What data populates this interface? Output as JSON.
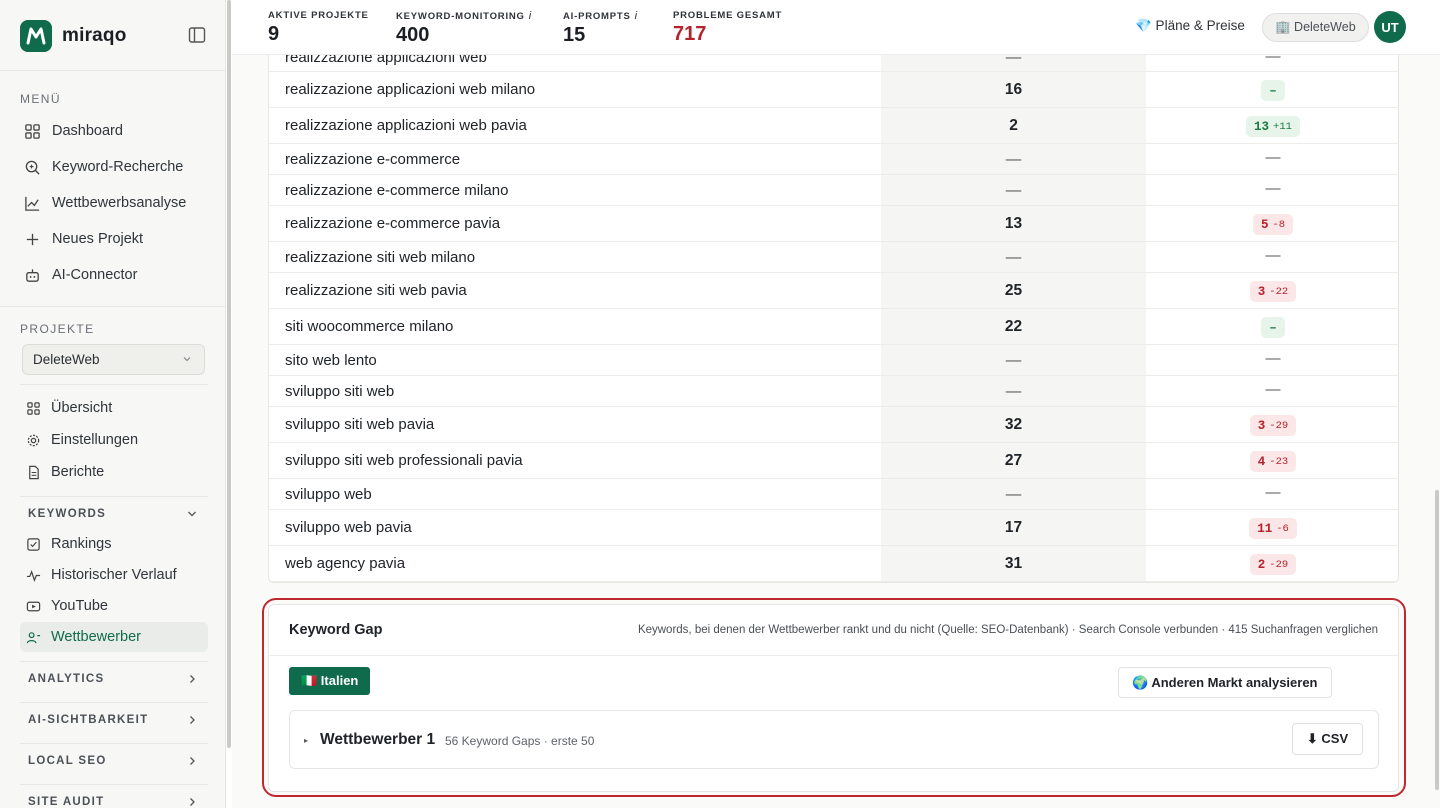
{
  "brand": {
    "name": "miraqo"
  },
  "sidebar": {
    "menu_heading": "MENÜ",
    "menu_items": [
      {
        "label": "Dashboard",
        "icon": "grid-icon"
      },
      {
        "label": "Keyword-Recherche",
        "icon": "search-icon"
      },
      {
        "label": "Wettbewerbsanalyse",
        "icon": "chart-line-icon"
      },
      {
        "label": "Neues Projekt",
        "icon": "plus-icon"
      },
      {
        "label": "AI-Connector",
        "icon": "robot-icon"
      }
    ],
    "projects_heading": "PROJEKTE",
    "project_select": "DeleteWeb",
    "project_items": [
      {
        "label": "Übersicht",
        "icon": "grid-icon"
      },
      {
        "label": "Einstellungen",
        "icon": "gear-icon"
      },
      {
        "label": "Berichte",
        "icon": "document-icon"
      }
    ],
    "keywords_group": "KEYWORDS",
    "keyword_items": [
      {
        "label": "Rankings",
        "icon": "checkbox-icon"
      },
      {
        "label": "Historischer Verlauf",
        "icon": "activity-icon"
      },
      {
        "label": "YouTube",
        "icon": "video-icon"
      },
      {
        "label": "Wettbewerber",
        "icon": "users-icon",
        "active": true
      }
    ],
    "groups": [
      "ANALYTICS",
      "AI-SICHTBARKEIT",
      "LOCAL SEO",
      "SITE AUDIT"
    ]
  },
  "topbar": {
    "stats": [
      {
        "label": "AKTIVE PROJEKTE",
        "value": "9",
        "info": ""
      },
      {
        "label": "KEYWORD-MONITORING",
        "value": "400",
        "info": "i"
      },
      {
        "label": "AI-PROMPTS",
        "value": "15",
        "info": "i"
      },
      {
        "label": "PROBLEME GESAMT",
        "value": "717",
        "info": ""
      }
    ],
    "plans_label": "💎 Pläne & Preise",
    "workspace_label": "🏢 DeleteWeb",
    "avatar_initials": "UT"
  },
  "rankings": [
    {
      "keyword": "realizzazione applicazioni web",
      "position": "—",
      "change": "—",
      "delta": "",
      "tone": "none"
    },
    {
      "keyword": "realizzazione applicazioni web milano",
      "position": "16",
      "change": "–",
      "delta": "",
      "tone": "green"
    },
    {
      "keyword": "realizzazione applicazioni web pavia",
      "position": "2",
      "change": "13",
      "delta": "+11",
      "tone": "green"
    },
    {
      "keyword": "realizzazione e-commerce",
      "position": "—",
      "change": "—",
      "delta": "",
      "tone": "none"
    },
    {
      "keyword": "realizzazione e-commerce milano",
      "position": "—",
      "change": "—",
      "delta": "",
      "tone": "none"
    },
    {
      "keyword": "realizzazione e-commerce pavia",
      "position": "13",
      "change": "5",
      "delta": "-8",
      "tone": "red"
    },
    {
      "keyword": "realizzazione siti web milano",
      "position": "—",
      "change": "—",
      "delta": "",
      "tone": "none"
    },
    {
      "keyword": "realizzazione siti web pavia",
      "position": "25",
      "change": "3",
      "delta": "-22",
      "tone": "red"
    },
    {
      "keyword": "siti woocommerce milano",
      "position": "22",
      "change": "–",
      "delta": "",
      "tone": "green"
    },
    {
      "keyword": "sito web lento",
      "position": "—",
      "change": "—",
      "delta": "",
      "tone": "none"
    },
    {
      "keyword": "sviluppo siti web",
      "position": "—",
      "change": "—",
      "delta": "",
      "tone": "none"
    },
    {
      "keyword": "sviluppo siti web pavia",
      "position": "32",
      "change": "3",
      "delta": "-29",
      "tone": "red"
    },
    {
      "keyword": "sviluppo siti web professionali pavia",
      "position": "27",
      "change": "4",
      "delta": "-23",
      "tone": "red"
    },
    {
      "keyword": "sviluppo web",
      "position": "—",
      "change": "—",
      "delta": "",
      "tone": "none"
    },
    {
      "keyword": "sviluppo web pavia",
      "position": "17",
      "change": "11",
      "delta": "-6",
      "tone": "red"
    },
    {
      "keyword": "web agency pavia",
      "position": "31",
      "change": "2",
      "delta": "-29",
      "tone": "red"
    }
  ],
  "keyword_gap": {
    "title": "Keyword Gap",
    "description": "Keywords, bei denen der Wettbewerber rankt und du nicht (Quelle: SEO-Datenbank) · Search Console verbunden · 415 Suchanfragen verglichen",
    "market_button": "🇮🇹 Italien",
    "other_market_button": "🌍 Anderen Markt analysieren",
    "competitor": {
      "toggle": "▸",
      "name": "Wettbewerber 1",
      "meta": "56 Keyword Gaps · erste 50",
      "csv_label": "⬇  CSV"
    }
  },
  "colors": {
    "brand": "#0f6b4b",
    "danger": "#b4232a",
    "highlight_outline": "#c0282f"
  }
}
